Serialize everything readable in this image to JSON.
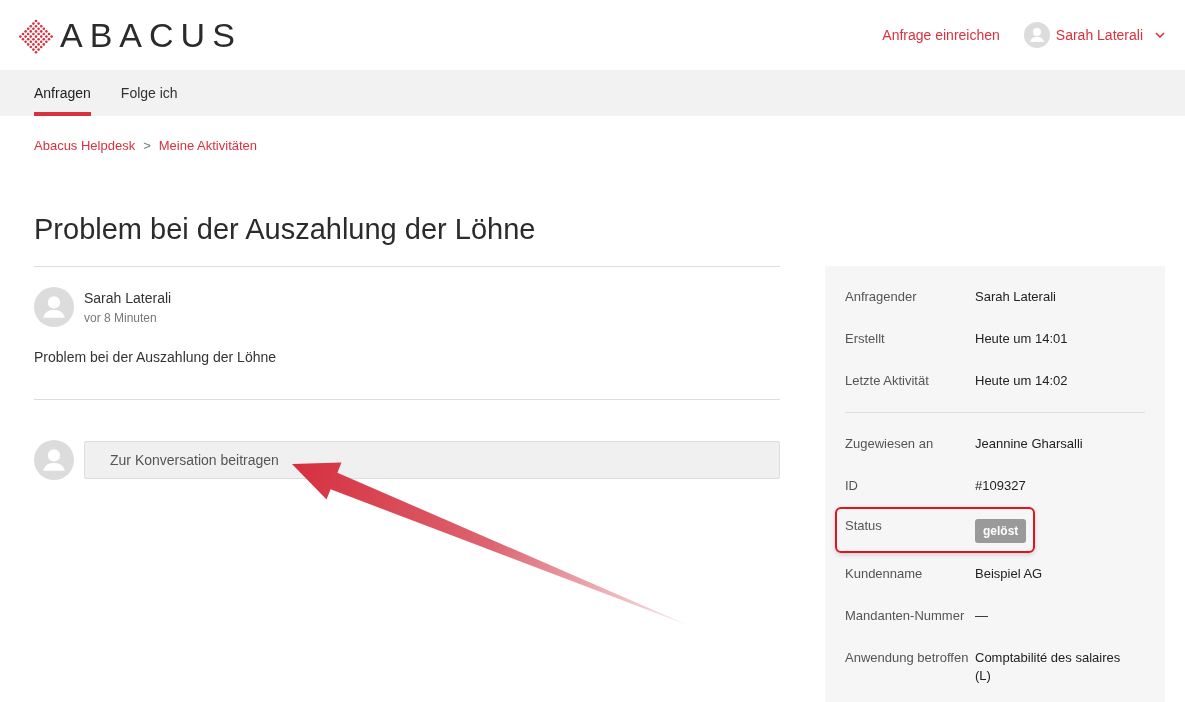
{
  "header": {
    "logo": "ABACUS",
    "submit_link": "Anfrage einreichen",
    "user": "Sarah Laterali"
  },
  "tabs": [
    {
      "label": "Anfragen",
      "selected": true
    },
    {
      "label": "Folge ich",
      "selected": false
    }
  ],
  "breadcrumb": [
    "Abacus Helpdesk",
    "Meine Aktivitäten"
  ],
  "breadcrumb_separator": ">",
  "title": "Problem bei der Auszahlung der Löhne",
  "post": {
    "author": "Sarah Laterali",
    "time": "vor 8 Minuten",
    "body": "Problem bei der Auszahlung der Löhne"
  },
  "reply": {
    "placeholder": "Zur Konversation beitragen"
  },
  "details": [
    [
      {
        "label": "Anfragender",
        "value": "Sarah Laterali",
        "kind": "text",
        "highlighted": false
      },
      {
        "label": "Erstellt",
        "value": "Heute um 14:01",
        "kind": "text",
        "highlighted": false
      },
      {
        "label": "Letzte Aktivität",
        "value": "Heute um 14:02",
        "kind": "text",
        "highlighted": false
      }
    ],
    [
      {
        "label": "Zugewiesen an",
        "value": "Jeannine Gharsalli",
        "kind": "text",
        "highlighted": false
      },
      {
        "label": "ID",
        "value": "#109327",
        "kind": "text",
        "highlighted": false
      },
      {
        "label": "Status",
        "value": "gelöst",
        "kind": "badge",
        "highlighted": true
      },
      {
        "label": "Kundenname",
        "value": "Beispiel AG",
        "kind": "text",
        "highlighted": false
      },
      {
        "label": "Mandanten-Nummer",
        "value": "—",
        "kind": "text",
        "highlighted": false
      },
      {
        "label": "Anwendung betroffen",
        "value": "Comptabilité des salaires (L)",
        "kind": "text",
        "highlighted": false
      }
    ]
  ]
}
